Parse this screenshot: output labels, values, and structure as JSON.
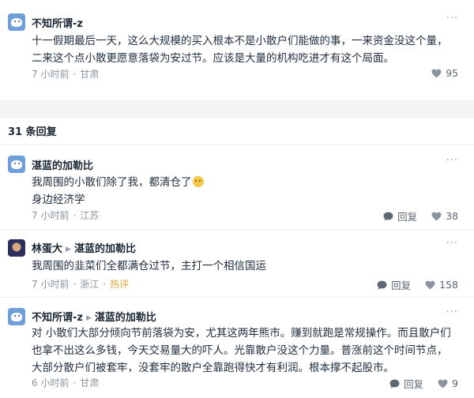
{
  "top_post": {
    "author": "不知所谓-z",
    "lines": [
      "十一假期最后一天，这么大规模的买入根本不是小散户们能做的事，一来资金没这个量，",
      "二来这个点小散更愿意落袋为安过节。应该是大量的机构吃进才有这个局面。"
    ],
    "time": "7 小时前",
    "location": "甘肃",
    "likes": "95"
  },
  "replies_header": "31 条回复",
  "more_icon": "more-dots-icon",
  "reply_label": "回复",
  "replies": [
    {
      "author": "湛蓝的加勒比",
      "reply_to": "",
      "lines": [
        "我周围的小散们除了我，都清仓了",
        "身边经济学"
      ],
      "time": "7 小时前",
      "location": "江苏",
      "tag": "",
      "likes": "38"
    },
    {
      "author": "林蛋大",
      "reply_to": "湛蓝的加勒比",
      "lines": [
        "我周围的韭菜们全都满仓过节，主打一个相信国运"
      ],
      "time": "7 小时前",
      "location": "浙江",
      "tag": "热评",
      "likes": "158"
    },
    {
      "author": "不知所谓-z",
      "reply_to": "湛蓝的加勒比",
      "lines": [
        "对 小散们大部分倾向节前落袋为安，尤其这两年熊市。赚到就跑是常规操作。而且散户们",
        "也拿不出这么多钱，今天交易量大的吓人。光靠散户没这个力量。普涨前这个时间节点，",
        "大部分散户们被套牢，没套牢的散户全靠跑得快才有利润。根本撑不起股市。"
      ],
      "time": "6 小时前",
      "location": "甘肃",
      "tag": "",
      "likes": "9"
    }
  ]
}
